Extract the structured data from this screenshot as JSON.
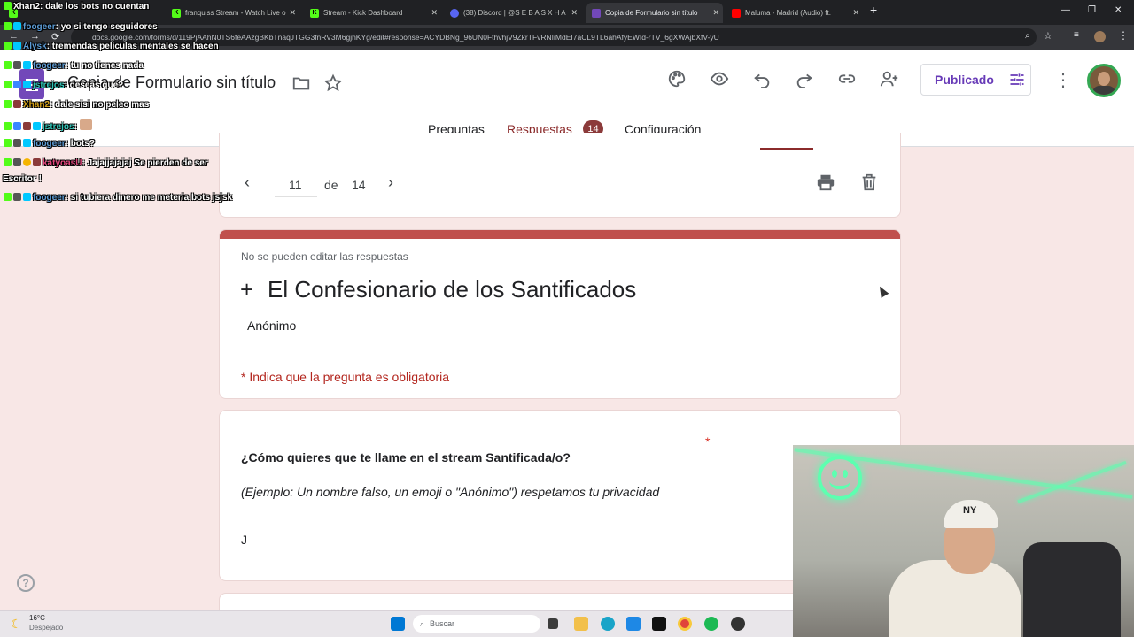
{
  "browser": {
    "tabs": [
      {
        "title": "Kick",
        "favicon": "kick-icon",
        "color": "#53fc18",
        "active": false
      },
      {
        "title": "franquiss Stream - Watch Live o",
        "favicon": "kick-icon",
        "color": "#53fc18",
        "active": false
      },
      {
        "title": "Stream - Kick Dashboard",
        "favicon": "kick-icon",
        "color": "#53fc18",
        "active": false
      },
      {
        "title": "(38) Discord | @S E B A S X H A",
        "favicon": "discord-icon",
        "color": "#5865f2",
        "active": false
      },
      {
        "title": "Copia de Formulario sin título",
        "favicon": "forms-icon",
        "color": "#7248b9",
        "active": true
      },
      {
        "title": "Maluma - Madrid (Audio) ft.",
        "favicon": "youtube-icon",
        "color": "#ff0000",
        "active": false
      }
    ],
    "url": "docs.google.com/forms/d/119PjAAhN0TS6feAAzgBKbTnaqJTGG3fnRV3M6gjhKYg/edit#response=ACYDBNg_96UN0FthvhjV9ZkrTFvRNIiMdEI7aCL9TL6ahAfyEWId-rTV_6gXWAjbXfV-yU"
  },
  "forms_header": {
    "title": "Copia de Formulario sin título",
    "publish_label": "Publicado",
    "tabs": [
      {
        "label": "Preguntas"
      },
      {
        "label": "Respuestas"
      },
      {
        "label": "Configuración"
      }
    ],
    "response_count": "14",
    "accent": "#673ab7",
    "theme": "#8b2b2b"
  },
  "navigator": {
    "current": "11",
    "of_label": "de",
    "total": "14"
  },
  "form": {
    "no_edit_notice": "No se pueden editar las respuestas",
    "title": "El Confesionario de los Santificados",
    "title_prefix": "+",
    "respondent": "Anónimo",
    "required_notice": "* Indica que la pregunta es obligatoria",
    "questions": [
      {
        "question": "¿Cómo quieres que te llame en el stream Santificada/o?",
        "required_mark": "*",
        "description": "(Ejemplo: Un nombre falso, un emoji o \"Anónimo\") respetamos tu privacidad",
        "answer": "J"
      }
    ]
  },
  "chat": [
    {
      "user": "Xhan2",
      "message": ": dale los bots no cuentan",
      "color": "#ffffff"
    },
    {
      "user": "foogeer",
      "message": ": yo si tengo seguidores",
      "color": "#5b9bd5"
    },
    {
      "user": "Alysk",
      "message": ": tremendas peliculas mentales se hacen",
      "color": "#5b9bd5"
    },
    {
      "user": "foogeer",
      "message": ": tu no tienes nada",
      "color": "#5b9bd5"
    },
    {
      "user": "jstrejos",
      "message": ": deseas que?",
      "color": "#2ec4b6"
    },
    {
      "user": "Xhan2",
      "message": ": dale sisi no peleo mas",
      "color": "#d4a017"
    },
    {
      "user": "jstrejos",
      "message": ":",
      "color": "#2ec4b6"
    },
    {
      "user": "foogeer",
      "message": ": bots?",
      "color": "#5b9bd5"
    },
    {
      "user": "katyoasU",
      "message": ": Jajajjajajaj Se pierden de ser",
      "color": "#e0457b"
    },
    {
      "user": "",
      "message": "Escritor !",
      "color": "#ffffff"
    },
    {
      "user": "foogeer",
      "message": ": si tubiera dinero me meteria bots jsjsk",
      "color": "#5b9bd5"
    }
  ],
  "taskbar": {
    "weather_temp": "16°C",
    "weather_desc": "Despejado",
    "search_placeholder": "Buscar"
  }
}
